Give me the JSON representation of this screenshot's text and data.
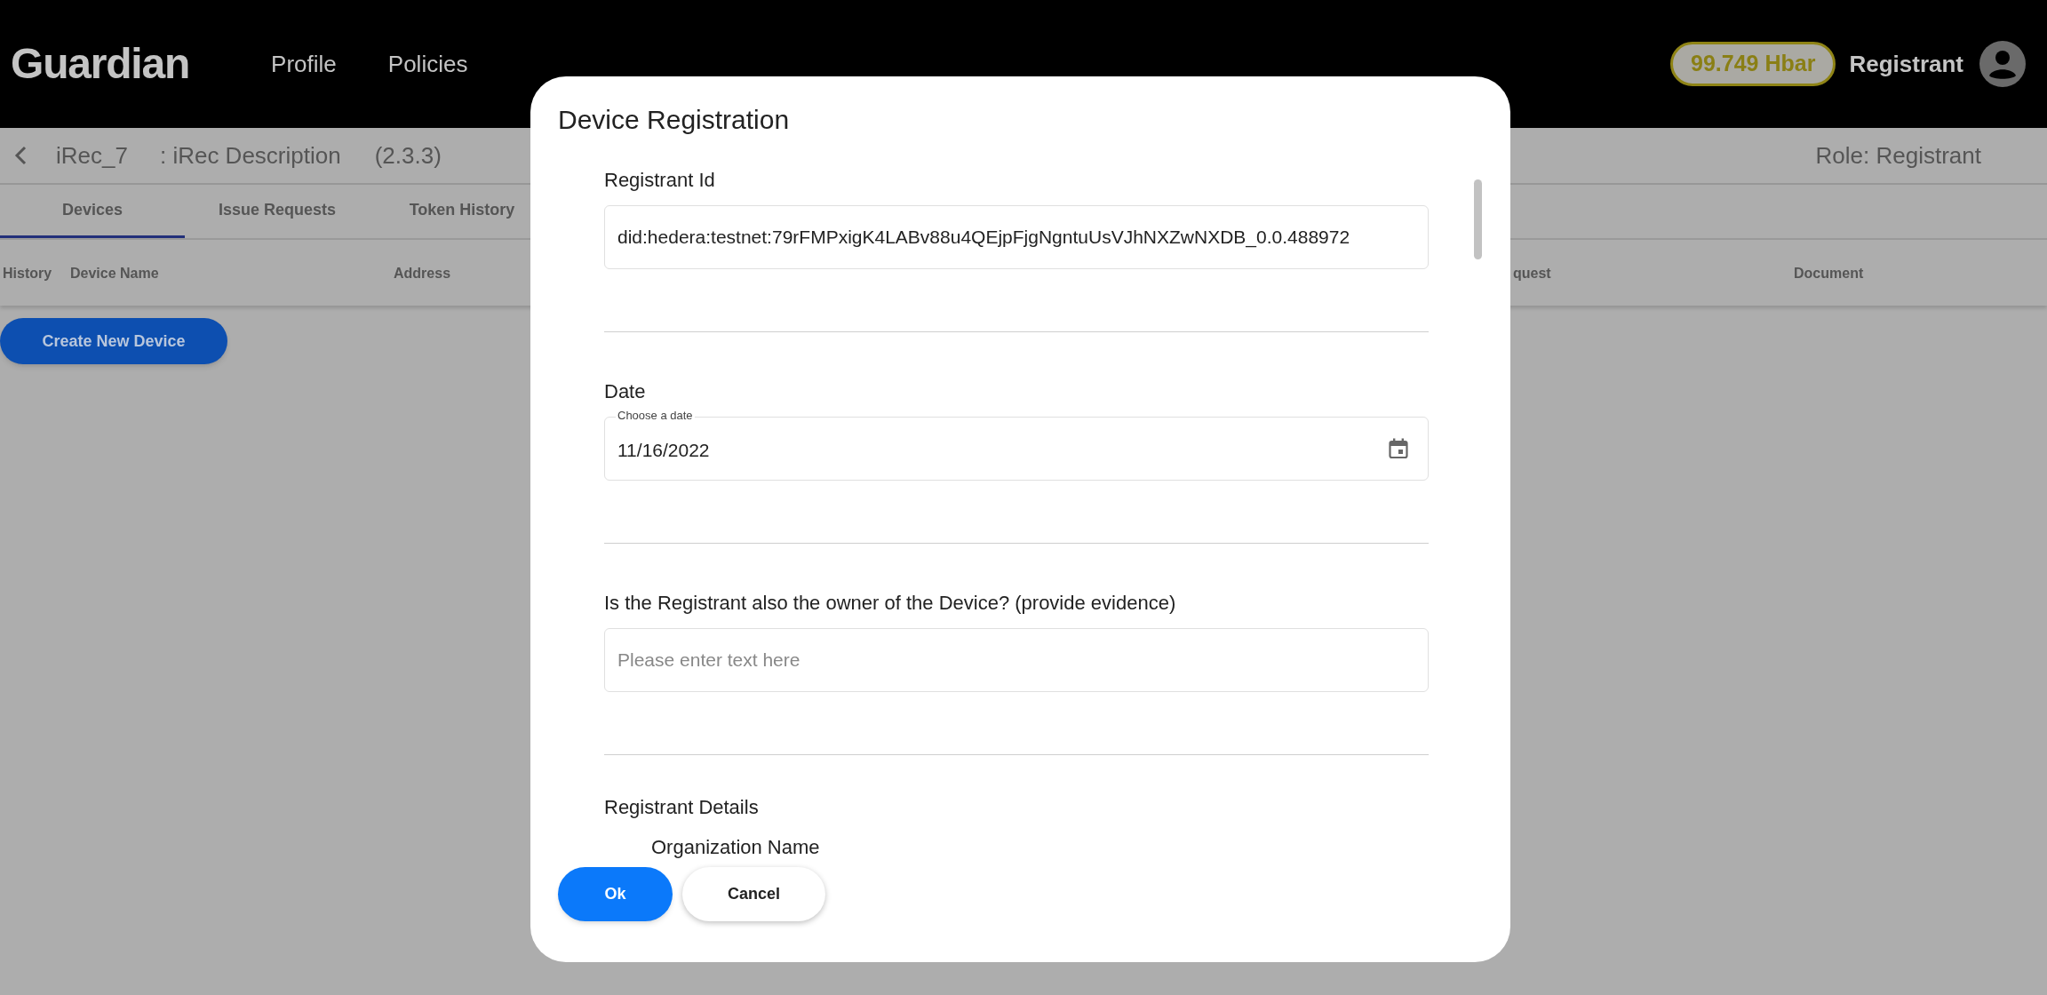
{
  "header": {
    "logo": "Guardian",
    "nav": [
      {
        "label": "Profile"
      },
      {
        "label": "Policies"
      }
    ],
    "balance": "99.749 Hbar",
    "user": "Registrant"
  },
  "policy_bar": {
    "name": "iRec_7",
    "description": ": iRec Description",
    "version": "(2.3.3)",
    "role": "Role: Registrant"
  },
  "tabs": [
    {
      "label": "Devices",
      "selected": true
    },
    {
      "label": "Issue Requests",
      "selected": false
    },
    {
      "label": "Token History",
      "selected": false
    }
  ],
  "table": {
    "columns": [
      "History",
      "Device Name",
      "Address",
      "quest",
      "Document"
    ]
  },
  "create_button": "Create New Device",
  "dialog": {
    "title": "Device Registration",
    "fields": [
      {
        "kind": "text",
        "label": "Registrant Id",
        "value": "did:hedera:testnet:79rFMPxigK4LABv88u4QEjpFjgNgntuUsVJhNXZwNXDB_0.0.488972"
      },
      {
        "kind": "date",
        "label": "Date",
        "floating_label": "Choose a date",
        "value": "11/16/2022"
      },
      {
        "kind": "text",
        "label": "Is the Registrant also the owner of the Device? (provide evidence)",
        "placeholder": "Please enter text here"
      }
    ],
    "section": {
      "title": "Registrant Details",
      "subfield_label": "Organization Name"
    },
    "buttons": [
      {
        "label": "Ok",
        "kind": "primary"
      },
      {
        "label": "Cancel",
        "kind": "secondary"
      }
    ]
  }
}
